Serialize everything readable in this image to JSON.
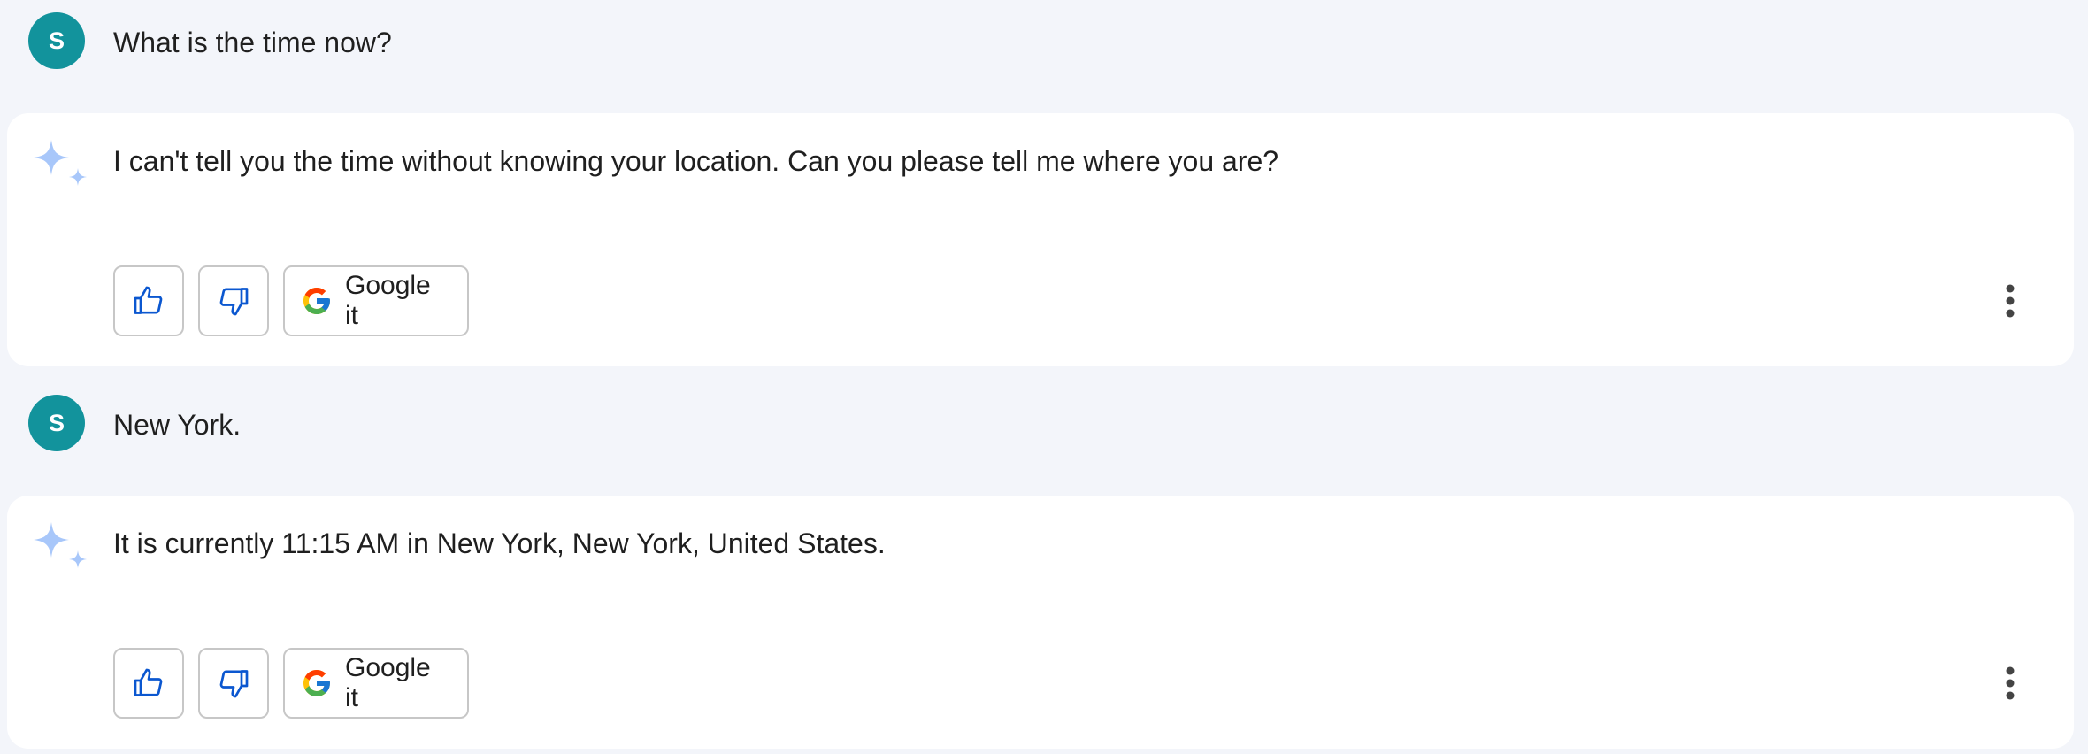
{
  "conversation": [
    {
      "user": {
        "avatar_letter": "S",
        "text": "What is the time now?"
      },
      "reply": {
        "text": "I can't tell you the time without knowing your location. Can you please tell me where you are?",
        "google_label": "Google it"
      }
    },
    {
      "user": {
        "avatar_letter": "S",
        "text": "New York."
      },
      "reply": {
        "text": "It is currently 11:15 AM in New York, New York, United States.",
        "google_label": "Google it"
      }
    }
  ],
  "colors": {
    "background": "#f3f5fa",
    "avatar": "#12939c",
    "card": "#ffffff",
    "icon_blue": "#0b57d0",
    "sparkle": "#a8c7fa"
  },
  "icons": [
    "sparkle-icon",
    "thumbs-up-icon",
    "thumbs-down-icon",
    "google-g-icon",
    "more-vert-icon"
  ]
}
